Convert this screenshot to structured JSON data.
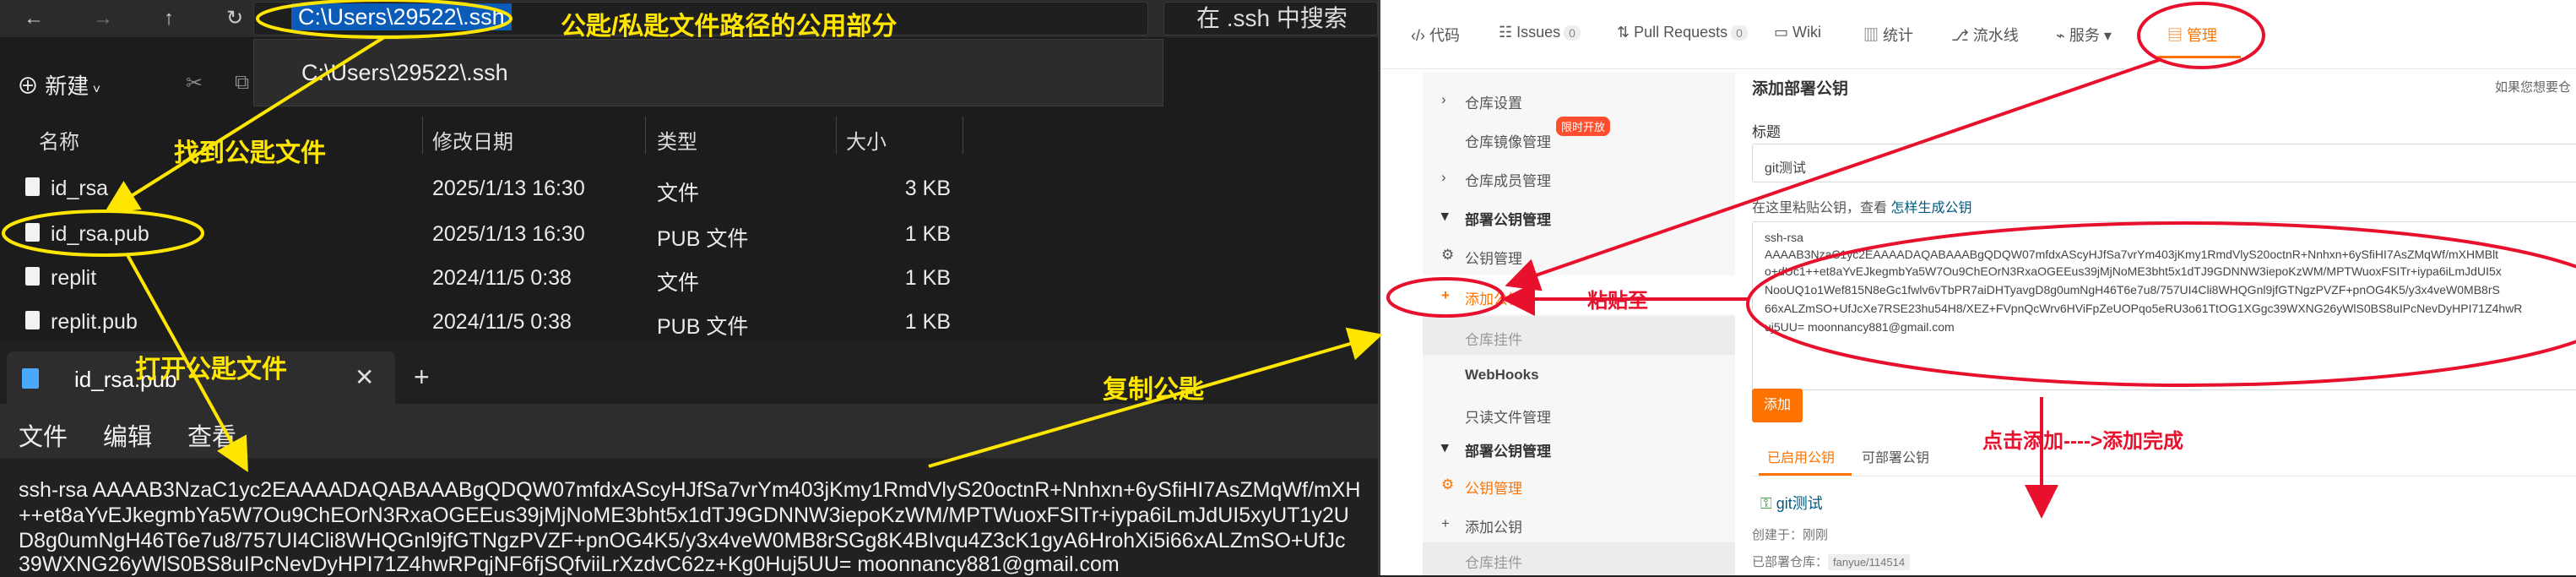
{
  "explorer": {
    "address_path": "C:\\Users\\29522\\.ssh",
    "search_placeholder": "在 .ssh 中搜索",
    "suggestion": "C:\\Users\\29522\\.ssh",
    "new_label": "新建",
    "columns": [
      "名称",
      "修改日期",
      "类型",
      "大小"
    ],
    "files": [
      {
        "name": "id_rsa",
        "date": "2025/1/13 16:30",
        "type": "文件",
        "size": "3 KB"
      },
      {
        "name": "id_rsa.pub",
        "date": "2025/1/13 16:30",
        "type": "PUB 文件",
        "size": "1 KB"
      },
      {
        "name": "replit",
        "date": "2024/11/5 0:38",
        "type": "文件",
        "size": "1 KB"
      },
      {
        "name": "replit.pub",
        "date": "2024/11/5 0:38",
        "type": "PUB 文件",
        "size": "1 KB"
      }
    ]
  },
  "notepad": {
    "tab_title": "id_rsa.pub",
    "menu": [
      "文件",
      "编辑",
      "查看"
    ],
    "lines": [
      "ssh-rsa AAAAB3NzaC1yc2EAAAADAQABAAABgQDQW07mfdxAScyHJfSa7vrYm403jKmy1RmdVlyS20octnR+Nnhxn+6ySfiHI7AsZMqWf/mXH",
      "++et8aYvEJkegmbYa5W7Ou9ChEOrN3RxaOGEEus39jMjNoME3bht5x1dTJ9GDNNW3iepoKzWM/MPTWuoxFSITr+iypa6iLmJdUI5xyUT1y2U",
      "D8g0umNgH46T6e7u8/757UI4Cli8WHQGnl9jfGTNgzPVZF+pnOG4K5/y3x4veW0MB8rSGg8K4BIvqu4Z3cK1gyA6HrohXi5i66xALZmSO+UfJc",
      "39WXNG26yWlS0BS8uIPcNevDyHPI71Z4hwRPqjNF6fjSQfviiLrXzdvC62z+Kg0Huj5UU= moonnancy881@gmail.com"
    ]
  },
  "gitee": {
    "tabs": [
      {
        "label": "代码",
        "badge": ""
      },
      {
        "label": "Issues",
        "badge": "0"
      },
      {
        "label": "Pull Requests",
        "badge": "0"
      },
      {
        "label": "Wiki",
        "badge": ""
      },
      {
        "label": "统计",
        "badge": ""
      },
      {
        "label": "流水线",
        "badge": ""
      },
      {
        "label": "服务",
        "badge": ""
      },
      {
        "label": "管理",
        "badge": ""
      }
    ],
    "sidebar": {
      "repo_settings": "仓库设置",
      "repo_mirror": "仓库镜像管理",
      "hot_badge": "限时开放",
      "repo_members": "仓库成员管理",
      "deploy_keys_group": "部署公钥管理",
      "key_manage": "公钥管理",
      "add_key": "添加公钥",
      "repo_mount": "仓库挂件",
      "webhooks": "WebHooks",
      "readonly_files": "只读文件管理",
      "deploy_keys_group2": "部署公钥管理",
      "key_manage2": "公钥管理",
      "add_key2": "添加公钥",
      "bottom_cut": "仓库挂件"
    },
    "main": {
      "heading": "添加部署公钥",
      "right_hint": "如果您想要仓",
      "title_label": "标题",
      "title_value": "git测试",
      "paste_hint": "在这里粘贴公钥，查看",
      "paste_link": "怎样生成公钥",
      "key_lines": [
        "ssh-rsa",
        "AAAAB3NzaC1yc2EAAAADAQABAAABgQDQW07mfdxAScyHJfSa7vrYm403jKmy1RmdVlyS20octnR+Nnhxn+6ySfiHI7AsZMqWf/mXHMBlt",
        "o+dUc1++et8aYvEJkegmbYa5W7Ou9ChEOrN3RxaOGEEus39jMjNoME3bht5x1dTJ9GDNNW3iepoKzWM/MPTWuoxFSITr+iypa6iLmJdUI5x",
        "NooUQ1o1Wef815N8eGc1fwlv6vTbPR7aiDHTyavgD8g0umNgH46T6e7u8/757UI4Cli8WHQGnl9jfGTNgzPVZF+pnOG4K5/y3x4veW0MB8rS",
        "66xALZmSO+UfJcXe7RSE23hu54H8/XEZ+FVpnQcWrv6HViFpZeUOPqo5eRU3o61TtOG1XGgc39WXNG26yWlS0BS8uIPcNevDyHPI71Z4hwR",
        "uj5UU= moonnancy881@gmail.com"
      ],
      "add_button": "添加",
      "enabled_tab": "已启用公钥",
      "available_tab": "可部署公钥",
      "key_title": "git测试",
      "creator_label": "创建于：",
      "creator_value": "刚刚",
      "deployed_label": "已部署仓库：",
      "deployed_value": "fanyue/114514"
    }
  },
  "annotations": {
    "path_note": "公匙/私匙文件路径的公用部分",
    "find_key": "找到公匙文件",
    "open_key": "打开公匙文件",
    "copy_key": "复制公匙",
    "paste_to": "粘贴至",
    "click_add": "点击添加---->添加完成"
  },
  "colors": {
    "accent": "#fe7300",
    "annotation_yellow": "#ffe600",
    "annotation_red": "#e8112d",
    "selection_blue": "#0a5cb8"
  }
}
